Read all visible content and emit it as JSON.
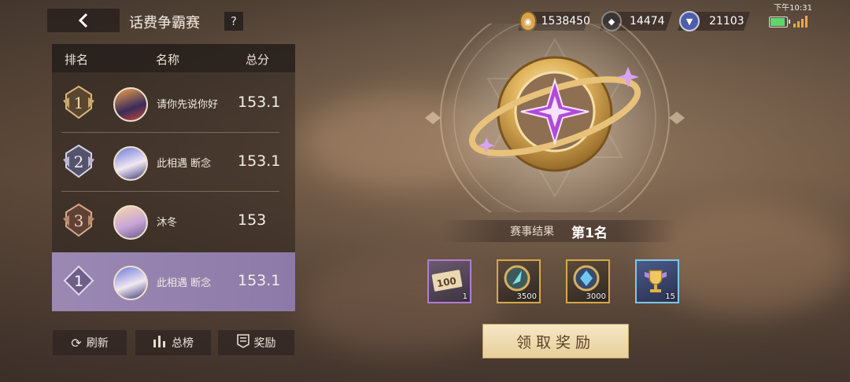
{
  "header": {
    "title": "话费争霸赛",
    "help_label": "?"
  },
  "status_bar": {
    "time": "下午10:31"
  },
  "currencies": [
    {
      "icon": "coin-icon",
      "value": "1538450",
      "color": "#d9a24a"
    },
    {
      "icon": "diamond-icon",
      "value": "14474",
      "color": "#6b6560"
    },
    {
      "icon": "shield-token-icon",
      "value": "21103",
      "color": "#4e5da8"
    }
  ],
  "leaderboard": {
    "columns": [
      "排名",
      "名称",
      "总分"
    ],
    "rows": [
      {
        "rank": "1",
        "name": "请你先说你好",
        "score": "153.1",
        "medal_color": "#c9a66b"
      },
      {
        "rank": "2",
        "name": "此相遇 断念",
        "score": "153.1",
        "medal_color": "#a8a6c2"
      },
      {
        "rank": "3",
        "name": "沐冬",
        "score": "153",
        "medal_color": "#b98a6a"
      }
    ],
    "my_row": {
      "rank": "1",
      "name": "此相遇 断念",
      "score": "153.1"
    }
  },
  "buttons": {
    "refresh": "刷新",
    "total_board": "总榜",
    "rewards": "奖励",
    "claim": "领取奖励"
  },
  "result": {
    "label": "赛事结果",
    "value": "第1名"
  },
  "rewards": [
    {
      "icon": "voucher-icon",
      "label": "100",
      "count": "1",
      "border": "#b57bd6"
    },
    {
      "icon": "feather-badge-icon",
      "count": "3500",
      "border": "#d9a84a"
    },
    {
      "icon": "gem-badge-icon",
      "count": "3000",
      "border": "#d9a84a"
    },
    {
      "icon": "trophy-icon",
      "count": "15",
      "border": "#7ec8e8"
    }
  ]
}
